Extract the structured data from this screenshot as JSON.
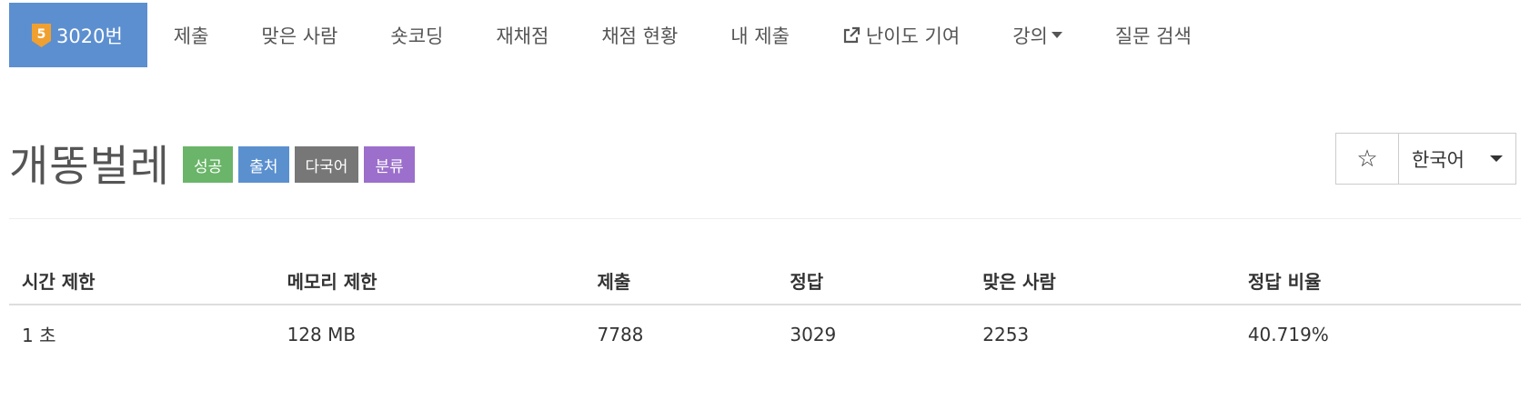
{
  "nav": {
    "problem": {
      "number_label": "3020번",
      "tier": "5",
      "tier_color": "#f0a030"
    },
    "items": [
      {
        "label": "제출"
      },
      {
        "label": "맞은 사람"
      },
      {
        "label": "숏코딩"
      },
      {
        "label": "재채점"
      },
      {
        "label": "채점 현황"
      },
      {
        "label": "내 제출"
      },
      {
        "label": "난이도 기여",
        "icon": "external-link-icon"
      },
      {
        "label": "강의",
        "has_caret": true
      },
      {
        "label": "질문 검색"
      }
    ]
  },
  "problem": {
    "title": "개똥벌레",
    "labels": [
      {
        "text": "성공",
        "color": "#6ab569"
      },
      {
        "text": "출처",
        "color": "#5b90cf"
      },
      {
        "text": "다국어",
        "color": "#777777"
      },
      {
        "text": "분류",
        "color": "#9b6fcb"
      }
    ]
  },
  "actions": {
    "star_icon": "☆",
    "language": "한국어"
  },
  "info_table": {
    "headers": [
      "시간 제한",
      "메모리 제한",
      "제출",
      "정답",
      "맞은 사람",
      "정답 비율"
    ],
    "rows": [
      [
        "1 초",
        "128 MB",
        "7788",
        "3029",
        "2253",
        "40.719%"
      ]
    ]
  },
  "colors": {
    "accent": "#5c8fd0"
  }
}
